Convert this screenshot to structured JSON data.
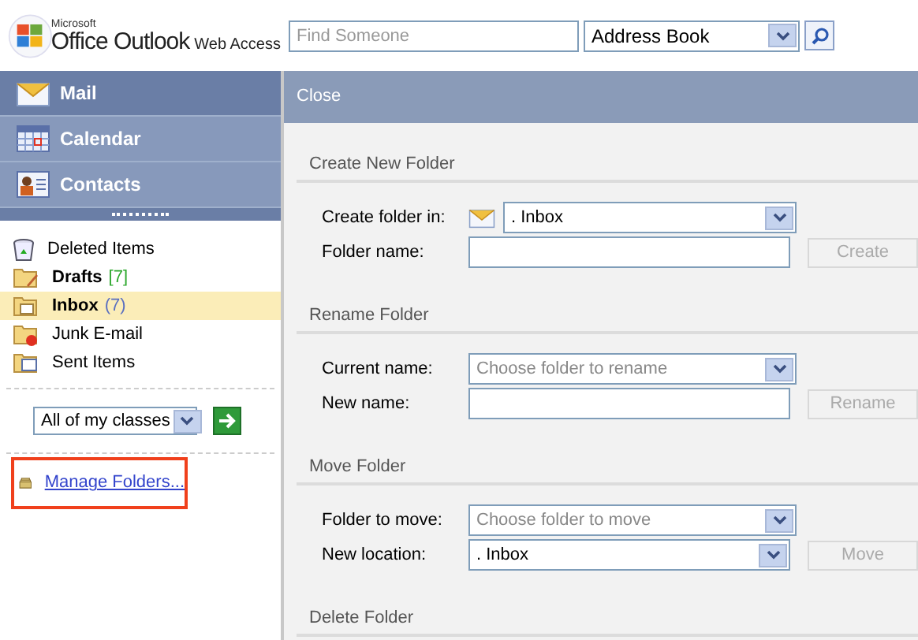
{
  "header": {
    "logo": {
      "maker": "Microsoft",
      "product": "Office Outlook",
      "suffix": "Web Access"
    },
    "search": {
      "placeholder": "Find Someone"
    },
    "address_book": {
      "value": "Address Book"
    }
  },
  "nav": [
    {
      "label": "Mail",
      "selected": true
    },
    {
      "label": "Calendar",
      "selected": false
    },
    {
      "label": "Contacts",
      "selected": false
    }
  ],
  "folders": [
    {
      "name": "Deleted Items",
      "bold": false,
      "selected": false
    },
    {
      "name": "Drafts",
      "bold": true,
      "count": "[7]",
      "color": "#2ea82e",
      "selected": false
    },
    {
      "name": "Inbox",
      "bold": true,
      "count": "(7)",
      "color": "#5a6fc0",
      "selected": true
    },
    {
      "name": "Junk E-mail",
      "bold": false,
      "selected": false
    },
    {
      "name": "Sent Items",
      "bold": false,
      "selected": false
    }
  ],
  "class_filter": {
    "value": "All of my classes"
  },
  "manage_folders": {
    "label": "Manage Folders...",
    "highlighted": true
  },
  "panel": {
    "close": "Close",
    "sections": [
      {
        "title": "Create New Folder",
        "rows": [
          {
            "label": "Create folder in:",
            "kind": "select",
            "value": ". Inbox",
            "icon": true
          },
          {
            "label": "Folder name:",
            "kind": "field"
          }
        ],
        "button": {
          "label": "Create",
          "disabled": true
        }
      },
      {
        "title": "Rename Folder",
        "rows": [
          {
            "label": "Current name:",
            "kind": "select",
            "placeholder": "Choose folder to rename"
          },
          {
            "label": "New name:",
            "kind": "field"
          }
        ],
        "button": {
          "label": "Rename",
          "disabled": true
        }
      },
      {
        "title": "Move Folder",
        "rows": [
          {
            "label": "Folder to move:",
            "kind": "select",
            "placeholder": "Choose folder to move"
          },
          {
            "label": "New location:",
            "kind": "select",
            "value": ". Inbox"
          }
        ],
        "button": {
          "label": "Move",
          "disabled": true
        }
      },
      {
        "title": "Delete Folder"
      }
    ]
  }
}
